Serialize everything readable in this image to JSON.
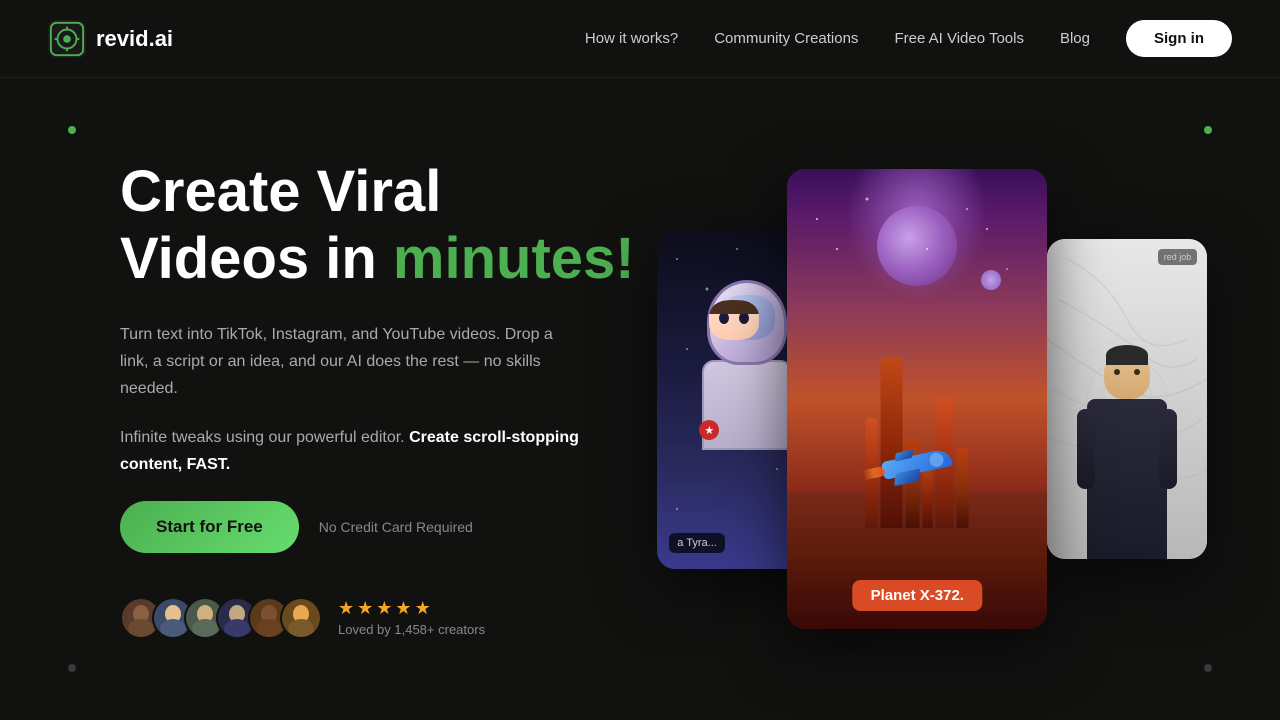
{
  "brand": {
    "name": "revid.ai",
    "logo_alt": "revid.ai logo"
  },
  "nav": {
    "links": [
      {
        "id": "how-it-works",
        "label": "How it works?"
      },
      {
        "id": "community-creations",
        "label": "Community Creations"
      },
      {
        "id": "free-ai-video-tools",
        "label": "Free AI Video Tools"
      },
      {
        "id": "blog",
        "label": "Blog"
      }
    ],
    "signin_label": "Sign in"
  },
  "hero": {
    "title_line1": "Create Viral",
    "title_line2_plain": "Videos in ",
    "title_line2_highlight": "minutes!",
    "description": "Turn text into TikTok, Instagram, and YouTube videos. Drop a link, a script or an idea, and our AI does the rest — no skills needed.",
    "description_bold": "Create scroll-stopping content, FAST.",
    "description_intro": "Infinite tweaks using our powerful editor.",
    "cta_button": "Start for Free",
    "no_cc_label": "No Credit Card Required",
    "stars_count": "★★★★★",
    "loved_text": "Loved by 1,458+ creators"
  },
  "cards": {
    "center_caption": "Planet X-372.",
    "left_label": "a Tyra...",
    "right_label": "red job"
  },
  "colors": {
    "accent_green": "#4CAF50",
    "bg_dark": "#111210"
  }
}
